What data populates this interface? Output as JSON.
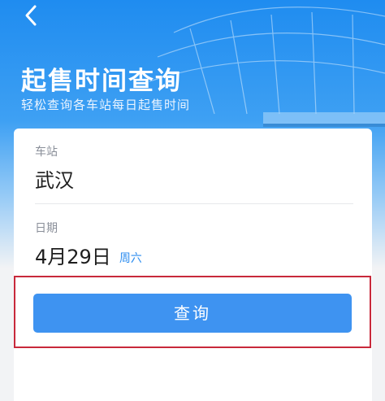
{
  "header": {
    "title": "起售时间查询",
    "subtitle": "轻松查询各车站每日起售时间",
    "back_icon": "chevron-left-icon"
  },
  "form": {
    "station": {
      "label": "车站",
      "value": "武汉"
    },
    "date": {
      "label": "日期",
      "value": "4月29日",
      "weekday": "周六"
    },
    "query_button_label": "查询"
  },
  "colors": {
    "primary": "#3e93f1",
    "hero_top": "#1f8cf0",
    "highlight_border": "#c8293b",
    "weekday_text": "#2f8ef0"
  }
}
